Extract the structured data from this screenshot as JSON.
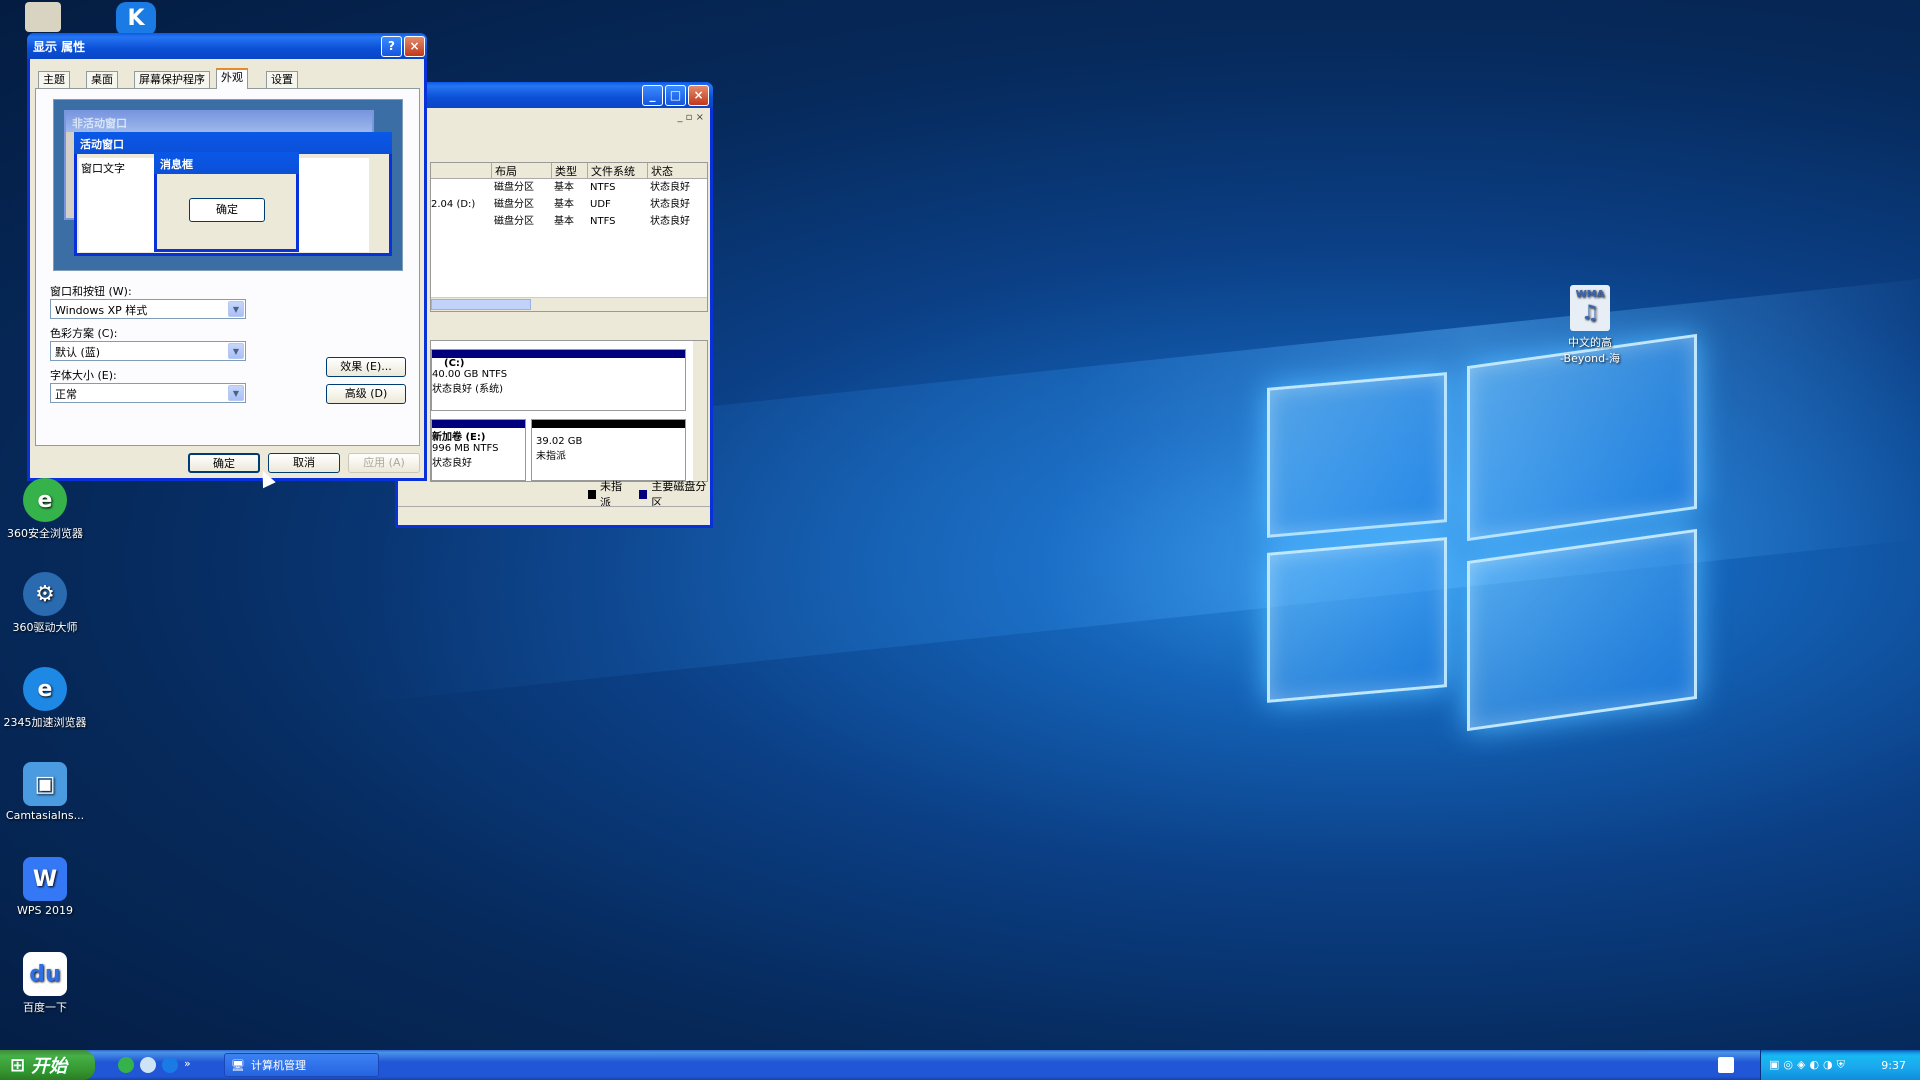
{
  "display_dialog": {
    "title": "显示 属性",
    "tabs": [
      "主题",
      "桌面",
      "屏幕保护程序",
      "外观",
      "设置"
    ],
    "preview": {
      "inactive_title": "非活动窗口",
      "active_title": "活动窗口",
      "window_text": "窗口文字",
      "msgbox_title": "消息框",
      "msgbox_ok": "确定"
    },
    "windows_buttons_label": "窗口和按钮 (W):",
    "windows_buttons_value": "Windows XP 样式",
    "color_scheme_label": "色彩方案 (C):",
    "color_scheme_value": "默认 (蓝)",
    "font_size_label": "字体大小 (E):",
    "font_size_value": "正常",
    "effects_button": "效果 (E)...",
    "advanced_button": "高级 (D)",
    "ok_button": "确定",
    "cancel_button": "取消",
    "apply_button": "应用 (A)"
  },
  "disk_mgmt": {
    "columns": [
      "布局",
      "类型",
      "文件系统",
      "状态"
    ],
    "rows": [
      {
        "vol": "",
        "layout": "磁盘分区",
        "type": "基本",
        "fs": "NTFS",
        "status": "状态良好"
      },
      {
        "vol": "2.04 (D:)",
        "layout": "磁盘分区",
        "type": "基本",
        "fs": "UDF",
        "status": "状态良好"
      },
      {
        "vol": "",
        "layout": "磁盘分区",
        "type": "基本",
        "fs": "NTFS",
        "status": "状态良好"
      }
    ],
    "part_c_name": "(C:)",
    "part_c_size": "40.00 GB NTFS",
    "part_c_status": "状态良好 (系统)",
    "part_e_name": "新加卷 (E:)",
    "part_e_size": "996 MB NTFS",
    "part_e_status": "状态良好",
    "unalloc_size": "39.02 GB",
    "unalloc_status": "未指派",
    "legend_unalloc": "未指派",
    "legend_primary": "主要磁盘分区"
  },
  "desktop_icons": [
    {
      "label": "360安全浏览器",
      "icon": "360-browser-icon",
      "color": "#36b24a"
    },
    {
      "label": "360驱动大师",
      "icon": "360-driver-icon",
      "color": "#2a6bb0"
    },
    {
      "label": "2345加速浏览器",
      "icon": "2345-browser-icon",
      "color": "#1e88e5"
    },
    {
      "label": "CamtasiaIns...",
      "icon": "camtasia-icon",
      "color": "#4a9be0"
    },
    {
      "label": "WPS 2019",
      "icon": "wps-icon",
      "color": "#3478f6"
    },
    {
      "label": "百度一下",
      "icon": "baidu-icon",
      "color": "#2f6fe6"
    }
  ],
  "wma_file": {
    "badge": "WMA",
    "label_line1": "中文的高",
    "label_line2": "-Beyond-海"
  },
  "taskbar": {
    "start": "开始",
    "task_item": "计算机管理",
    "clock": "9:37"
  }
}
